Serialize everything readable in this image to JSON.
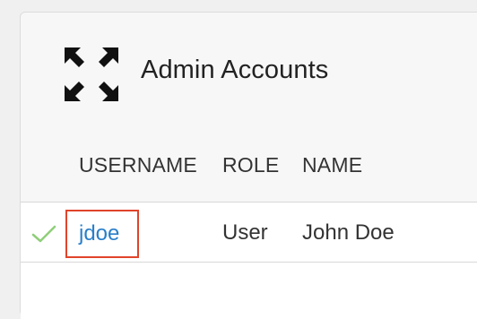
{
  "header": {
    "title": "Admin Accounts",
    "icon": "expand-arrows-icon"
  },
  "table": {
    "columns": [
      "USERNAME",
      "ROLE",
      "NAME"
    ],
    "rows": [
      {
        "status_icon": "check-icon",
        "username": "jdoe",
        "role": "User",
        "name": "John Doe"
      }
    ]
  },
  "colors": {
    "link": "#2a7fc9",
    "highlight_border": "#e0442b",
    "check": "#8fcf7a"
  }
}
